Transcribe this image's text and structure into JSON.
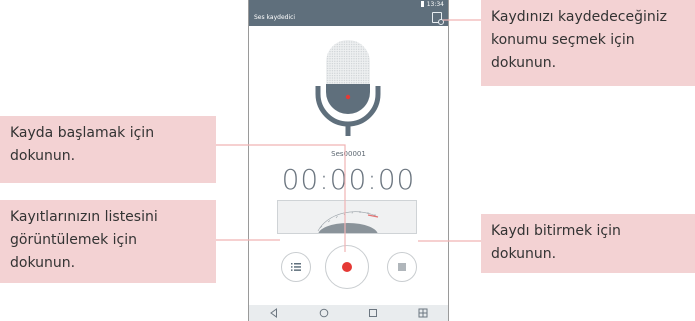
{
  "status_bar": {
    "time": "13:34"
  },
  "app_bar": {
    "title": "Ses kaydedici",
    "location_icon": "storage-location-icon"
  },
  "recorder": {
    "file_name": "Ses00001",
    "elapsed": "00:00:00"
  },
  "controls": {
    "list_icon": "list-icon",
    "record_icon": "record-icon",
    "stop_icon": "stop-icon"
  },
  "nav": [
    "back-icon",
    "home-icon",
    "recents-icon",
    "dual-window-icon"
  ],
  "callouts": {
    "location": [
      "Kaydınızı kaydedeceğiniz",
      "konumu seçmek için",
      "dokunun."
    ],
    "start": [
      "Kayda başlamak için",
      "dokunun."
    ],
    "list": [
      "Kayıtlarınızın listesini",
      "görüntülemek için",
      "dokunun."
    ],
    "stop": [
      "Kaydı bitirmek için",
      "dokunun."
    ]
  },
  "colors": {
    "app_bar": "#5f6f7c",
    "callout_bg": "#f3d2d3",
    "leader": "#f0b3b5",
    "record_red": "#e53935"
  }
}
